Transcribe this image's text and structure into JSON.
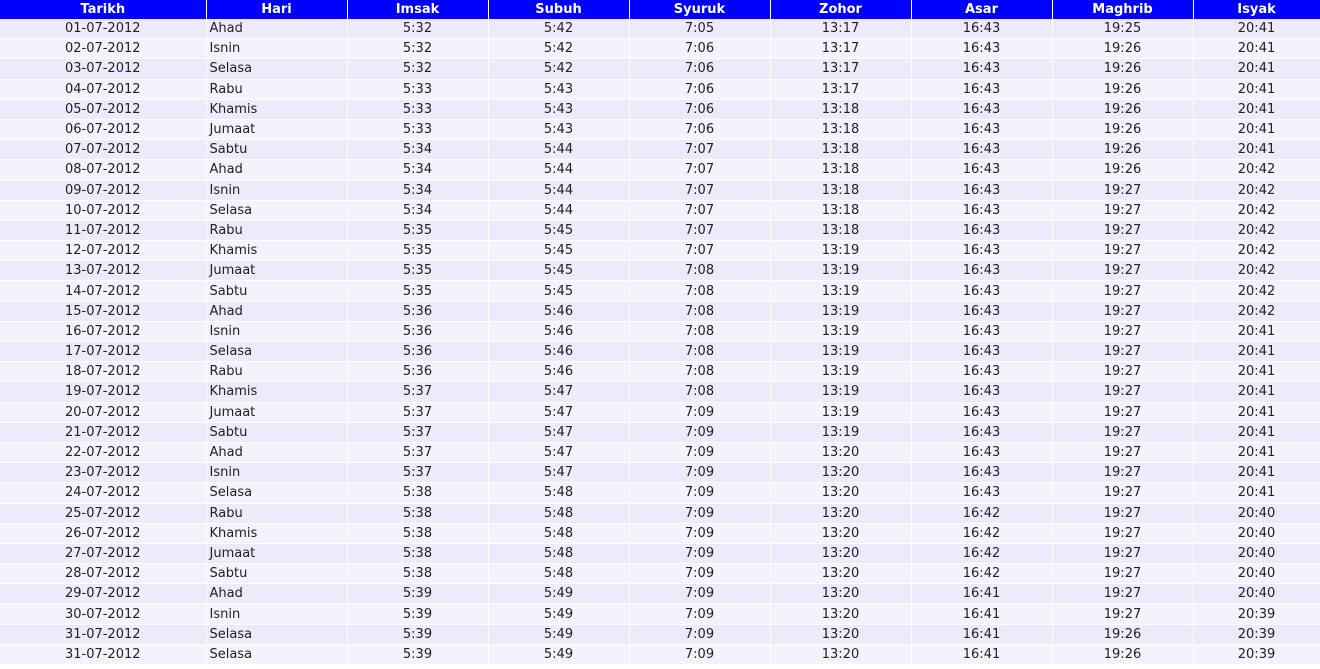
{
  "columns": [
    "Tarikh",
    "Hari",
    "Imsak",
    "Subuh",
    "Syuruk",
    "Zohor",
    "Asar",
    "Maghrib",
    "Isyak"
  ],
  "rows": [
    [
      "01-07-2012",
      "Ahad",
      "5:32",
      "5:42",
      "7:05",
      "13:17",
      "16:43",
      "19:25",
      "20:41"
    ],
    [
      "02-07-2012",
      "Isnin",
      "5:32",
      "5:42",
      "7:06",
      "13:17",
      "16:43",
      "19:26",
      "20:41"
    ],
    [
      "03-07-2012",
      "Selasa",
      "5:32",
      "5:42",
      "7:06",
      "13:17",
      "16:43",
      "19:26",
      "20:41"
    ],
    [
      "04-07-2012",
      "Rabu",
      "5:33",
      "5:43",
      "7:06",
      "13:17",
      "16:43",
      "19:26",
      "20:41"
    ],
    [
      "05-07-2012",
      "Khamis",
      "5:33",
      "5:43",
      "7:06",
      "13:18",
      "16:43",
      "19:26",
      "20:41"
    ],
    [
      "06-07-2012",
      "Jumaat",
      "5:33",
      "5:43",
      "7:06",
      "13:18",
      "16:43",
      "19:26",
      "20:41"
    ],
    [
      "07-07-2012",
      "Sabtu",
      "5:34",
      "5:44",
      "7:07",
      "13:18",
      "16:43",
      "19:26",
      "20:41"
    ],
    [
      "08-07-2012",
      "Ahad",
      "5:34",
      "5:44",
      "7:07",
      "13:18",
      "16:43",
      "19:26",
      "20:42"
    ],
    [
      "09-07-2012",
      "Isnin",
      "5:34",
      "5:44",
      "7:07",
      "13:18",
      "16:43",
      "19:27",
      "20:42"
    ],
    [
      "10-07-2012",
      "Selasa",
      "5:34",
      "5:44",
      "7:07",
      "13:18",
      "16:43",
      "19:27",
      "20:42"
    ],
    [
      "11-07-2012",
      "Rabu",
      "5:35",
      "5:45",
      "7:07",
      "13:18",
      "16:43",
      "19:27",
      "20:42"
    ],
    [
      "12-07-2012",
      "Khamis",
      "5:35",
      "5:45",
      "7:07",
      "13:19",
      "16:43",
      "19:27",
      "20:42"
    ],
    [
      "13-07-2012",
      "Jumaat",
      "5:35",
      "5:45",
      "7:08",
      "13:19",
      "16:43",
      "19:27",
      "20:42"
    ],
    [
      "14-07-2012",
      "Sabtu",
      "5:35",
      "5:45",
      "7:08",
      "13:19",
      "16:43",
      "19:27",
      "20:42"
    ],
    [
      "15-07-2012",
      "Ahad",
      "5:36",
      "5:46",
      "7:08",
      "13:19",
      "16:43",
      "19:27",
      "20:42"
    ],
    [
      "16-07-2012",
      "Isnin",
      "5:36",
      "5:46",
      "7:08",
      "13:19",
      "16:43",
      "19:27",
      "20:41"
    ],
    [
      "17-07-2012",
      "Selasa",
      "5:36",
      "5:46",
      "7:08",
      "13:19",
      "16:43",
      "19:27",
      "20:41"
    ],
    [
      "18-07-2012",
      "Rabu",
      "5:36",
      "5:46",
      "7:08",
      "13:19",
      "16:43",
      "19:27",
      "20:41"
    ],
    [
      "19-07-2012",
      "Khamis",
      "5:37",
      "5:47",
      "7:08",
      "13:19",
      "16:43",
      "19:27",
      "20:41"
    ],
    [
      "20-07-2012",
      "Jumaat",
      "5:37",
      "5:47",
      "7:09",
      "13:19",
      "16:43",
      "19:27",
      "20:41"
    ],
    [
      "21-07-2012",
      "Sabtu",
      "5:37",
      "5:47",
      "7:09",
      "13:19",
      "16:43",
      "19:27",
      "20:41"
    ],
    [
      "22-07-2012",
      "Ahad",
      "5:37",
      "5:47",
      "7:09",
      "13:20",
      "16:43",
      "19:27",
      "20:41"
    ],
    [
      "23-07-2012",
      "Isnin",
      "5:37",
      "5:47",
      "7:09",
      "13:20",
      "16:43",
      "19:27",
      "20:41"
    ],
    [
      "24-07-2012",
      "Selasa",
      "5:38",
      "5:48",
      "7:09",
      "13:20",
      "16:43",
      "19:27",
      "20:41"
    ],
    [
      "25-07-2012",
      "Rabu",
      "5:38",
      "5:48",
      "7:09",
      "13:20",
      "16:42",
      "19:27",
      "20:40"
    ],
    [
      "26-07-2012",
      "Khamis",
      "5:38",
      "5:48",
      "7:09",
      "13:20",
      "16:42",
      "19:27",
      "20:40"
    ],
    [
      "27-07-2012",
      "Jumaat",
      "5:38",
      "5:48",
      "7:09",
      "13:20",
      "16:42",
      "19:27",
      "20:40"
    ],
    [
      "28-07-2012",
      "Sabtu",
      "5:38",
      "5:48",
      "7:09",
      "13:20",
      "16:42",
      "19:27",
      "20:40"
    ],
    [
      "29-07-2012",
      "Ahad",
      "5:39",
      "5:49",
      "7:09",
      "13:20",
      "16:41",
      "19:27",
      "20:40"
    ],
    [
      "30-07-2012",
      "Isnin",
      "5:39",
      "5:49",
      "7:09",
      "13:20",
      "16:41",
      "19:27",
      "20:39"
    ],
    [
      "31-07-2012",
      "Selasa",
      "5:39",
      "5:49",
      "7:09",
      "13:20",
      "16:41",
      "19:26",
      "20:39"
    ],
    [
      "31-07-2012",
      "Selasa",
      "5:39",
      "5:49",
      "7:09",
      "13:20",
      "16:41",
      "19:26",
      "20:39"
    ]
  ],
  "colors": {
    "header_bg": "#0000ff",
    "header_text": "#ffffff",
    "row_bg": "#ebebfb",
    "row_alt_bg": "#f3f3fd"
  }
}
